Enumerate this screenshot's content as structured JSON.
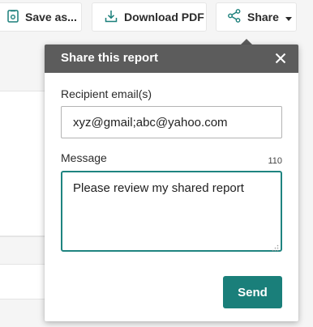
{
  "toolbar": {
    "save_label": "Save as...",
    "save_icon": "save-icon",
    "download_label": "Download PDF",
    "download_icon": "download-icon",
    "share_label": "Share",
    "share_icon": "share-icon",
    "share_caret_icon": "caret-down-icon"
  },
  "share_dialog": {
    "title": "Share this report",
    "close_icon": "close-icon",
    "recipients_label": "Recipient email(s)",
    "recipients_value": "xyz@gmail;abc@yahoo.com",
    "message_label": "Message",
    "message_char_count": "110",
    "message_value": "Please review my shared report",
    "send_label": "Send"
  },
  "colors": {
    "header_bg": "#5c5c5c",
    "accent": "#1a7f7a",
    "focus_border": "#1f8480"
  }
}
